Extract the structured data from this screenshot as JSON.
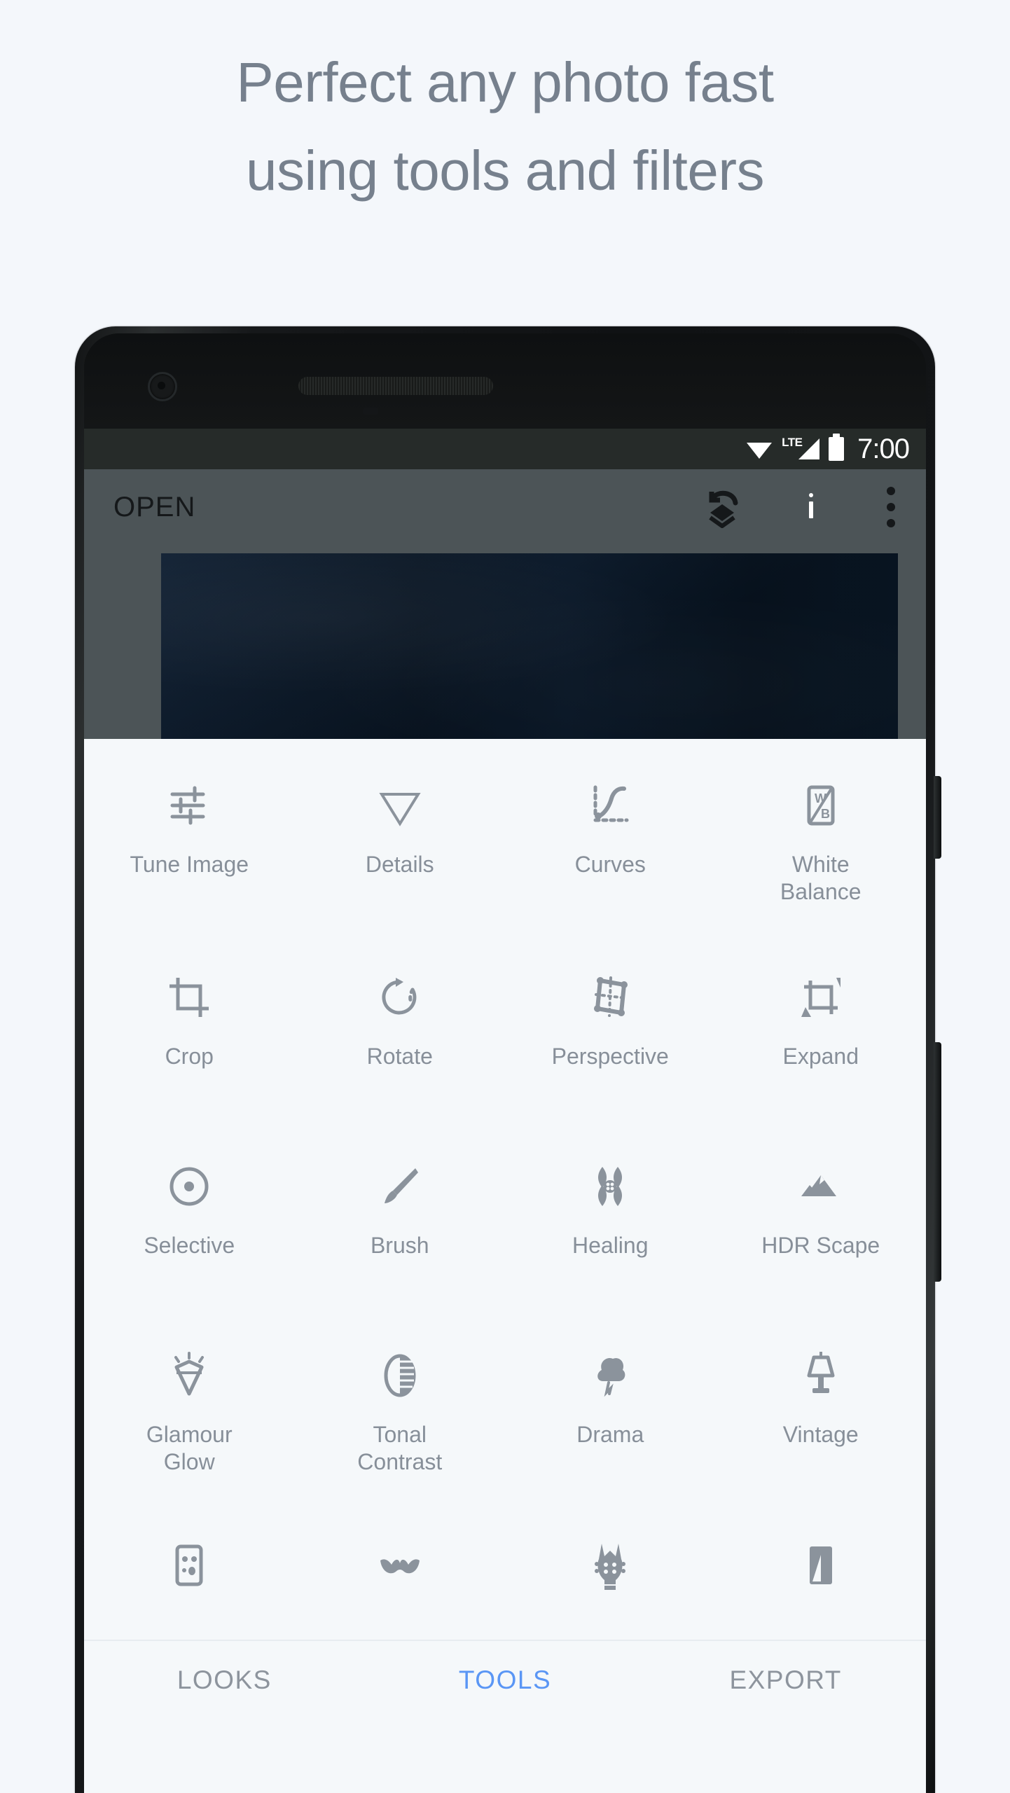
{
  "headline": {
    "line1": "Perfect any photo fast",
    "line2": "using tools and filters",
    "color": "#76808d"
  },
  "page": {
    "background_color": "#f4f7fb"
  },
  "phone": {
    "status_bar": {
      "background_color": "#262b29",
      "time": "7:00",
      "network_label": "LTE",
      "icons": [
        "wifi-icon",
        "lte-signal-icon",
        "battery-icon"
      ]
    },
    "app_bar": {
      "background_color": "#4c5457",
      "title": "OPEN",
      "actions": [
        "edit-stack-icon",
        "info-icon",
        "overflow-menu-icon"
      ]
    },
    "preview": {
      "background_color": "#4c5457",
      "photo_color": "#0a1828"
    },
    "tools_panel": {
      "background_color": "#f5f8fa",
      "label_color": "#878f99",
      "icon_color": "#8b939c",
      "rows": [
        [
          {
            "icon": "tune-image-icon",
            "label": "Tune Image"
          },
          {
            "icon": "details-icon",
            "label": "Details"
          },
          {
            "icon": "curves-icon",
            "label": "Curves"
          },
          {
            "icon": "white-balance-icon",
            "label": "White\nBalance"
          }
        ],
        [
          {
            "icon": "crop-icon",
            "label": "Crop"
          },
          {
            "icon": "rotate-icon",
            "label": "Rotate"
          },
          {
            "icon": "perspective-icon",
            "label": "Perspective"
          },
          {
            "icon": "expand-icon",
            "label": "Expand"
          }
        ],
        [
          {
            "icon": "selective-icon",
            "label": "Selective"
          },
          {
            "icon": "brush-icon",
            "label": "Brush"
          },
          {
            "icon": "healing-icon",
            "label": "Healing"
          },
          {
            "icon": "hdr-scape-icon",
            "label": "HDR Scape"
          }
        ],
        [
          {
            "icon": "glamour-glow-icon",
            "label": "Glamour\nGlow"
          },
          {
            "icon": "tonal-contrast-icon",
            "label": "Tonal\nContrast"
          },
          {
            "icon": "drama-icon",
            "label": "Drama"
          },
          {
            "icon": "vintage-icon",
            "label": "Vintage"
          }
        ],
        [
          {
            "icon": "grainy-film-icon",
            "label": ""
          },
          {
            "icon": "retrolux-icon",
            "label": ""
          },
          {
            "icon": "grunge-icon",
            "label": ""
          },
          {
            "icon": "black-and-white-icon",
            "label": ""
          }
        ]
      ]
    },
    "bottom_nav": {
      "active_color": "#5a96f5",
      "inactive_color": "#8d949d",
      "tabs": [
        {
          "label": "LOOKS",
          "active": false
        },
        {
          "label": "TOOLS",
          "active": true
        },
        {
          "label": "EXPORT",
          "active": false
        }
      ]
    },
    "hardware": {
      "front_camera": "front-camera",
      "earpiece": "earpiece-speaker",
      "power_button": "power-button",
      "volume_button": "volume-rocker"
    }
  }
}
